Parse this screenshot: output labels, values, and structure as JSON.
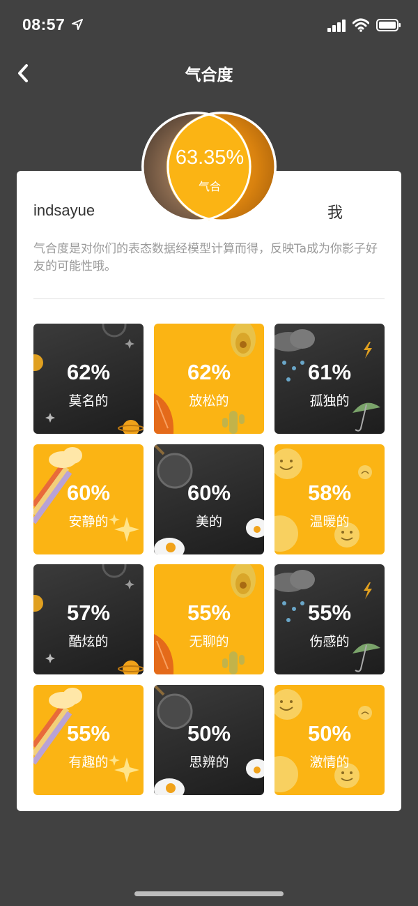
{
  "status_bar": {
    "time": "08:57"
  },
  "nav": {
    "title": "气合度"
  },
  "match": {
    "percent": "63.35%",
    "label": "气合"
  },
  "users": {
    "left_name": "indsayue",
    "right_name": "我"
  },
  "description": "气合度是对你们的表态数据经模型计算而得，反映Ta成为你影子好友的可能性哦。",
  "tiles": [
    {
      "percent": "62%",
      "label": "莫名的",
      "theme": "dark",
      "icon": "planet-stars"
    },
    {
      "percent": "62%",
      "label": "放松的",
      "theme": "yellow",
      "icon": "avocado-cactus"
    },
    {
      "percent": "61%",
      "label": "孤独的",
      "theme": "dark",
      "icon": "rain-umbrella"
    },
    {
      "percent": "60%",
      "label": "安静的",
      "theme": "yellow",
      "icon": "rainbow-sparkle"
    },
    {
      "percent": "60%",
      "label": "美的",
      "theme": "dark",
      "icon": "pan-egg"
    },
    {
      "percent": "58%",
      "label": "温暖的",
      "theme": "yellow",
      "icon": "smiley-faces"
    },
    {
      "percent": "57%",
      "label": "酷炫的",
      "theme": "dark",
      "icon": "planet-stars"
    },
    {
      "percent": "55%",
      "label": "无聊的",
      "theme": "yellow",
      "icon": "avocado-cactus"
    },
    {
      "percent": "55%",
      "label": "伤感的",
      "theme": "dark",
      "icon": "rain-umbrella"
    },
    {
      "percent": "55%",
      "label": "有趣的",
      "theme": "yellow",
      "icon": "rainbow-sparkle"
    },
    {
      "percent": "50%",
      "label": "思辨的",
      "theme": "dark",
      "icon": "pan-egg"
    },
    {
      "percent": "50%",
      "label": "激情的",
      "theme": "yellow",
      "icon": "smiley-faces"
    }
  ]
}
